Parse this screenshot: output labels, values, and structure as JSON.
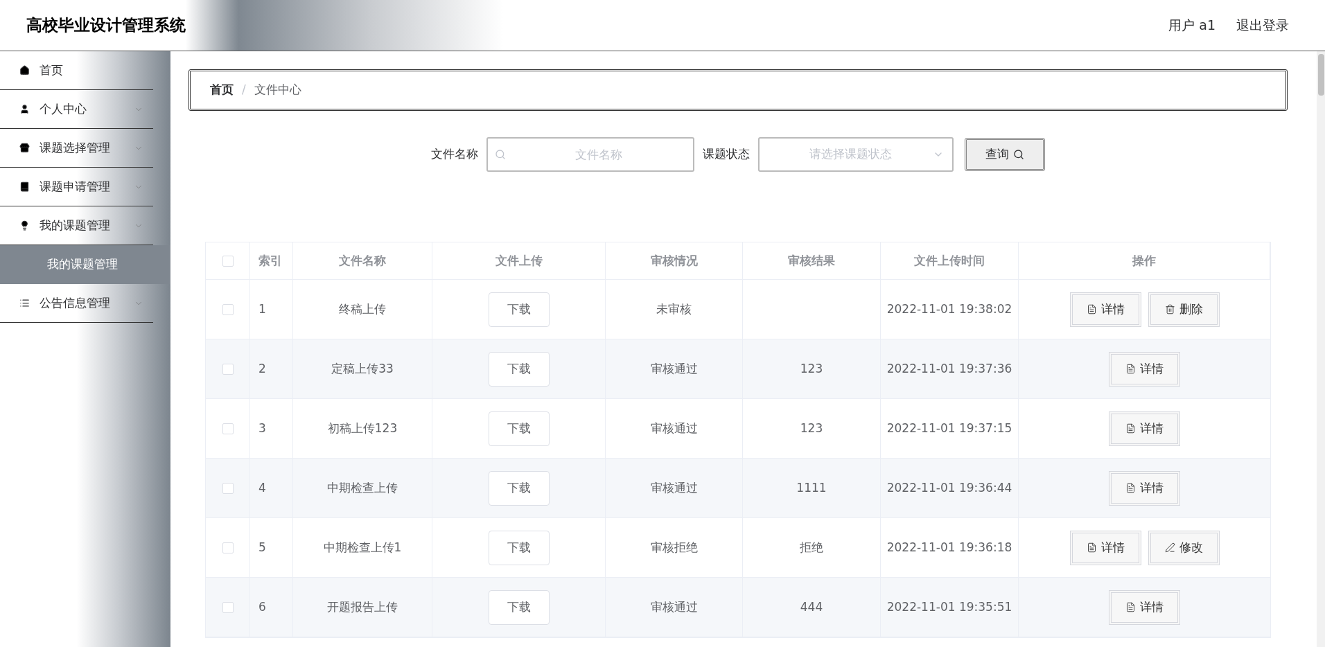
{
  "header": {
    "title": "高校毕业设计管理系统",
    "user": "用户 a1",
    "logout": "退出登录"
  },
  "sidebar": {
    "items": [
      {
        "label": "首页"
      },
      {
        "label": "个人中心"
      },
      {
        "label": "课题选择管理"
      },
      {
        "label": "课题申请管理"
      },
      {
        "label": "我的课题管理",
        "children": [
          {
            "label": "我的课题管理",
            "selected": true
          }
        ]
      },
      {
        "label": "公告信息管理"
      }
    ]
  },
  "breadcrumb": {
    "items": [
      "首页",
      "文件中心"
    ],
    "separator": "/"
  },
  "search": {
    "name_label": "文件名称",
    "name_placeholder": "文件名称",
    "status_label": "课题状态",
    "status_placeholder": "请选择课题状态",
    "query": "查询"
  },
  "table": {
    "select_all_checked": false,
    "columns": [
      "索引",
      "文件名称",
      "文件上传",
      "审核情况",
      "审核结果",
      "文件上传时间",
      "操作"
    ],
    "rows": [
      {
        "index": "1",
        "name": "终稿上传",
        "download": "下载",
        "audit": "未审核",
        "result": "",
        "time": "2022-11-01 19:38:02",
        "checked": false,
        "actions": [
          {
            "kind": "detail",
            "label": "详情"
          },
          {
            "kind": "delete",
            "label": "删除"
          }
        ]
      },
      {
        "index": "2",
        "name": "定稿上传33",
        "download": "下载",
        "audit": "审核通过",
        "result": "123",
        "time": "2022-11-01 19:37:36",
        "checked": false,
        "actions": [
          {
            "kind": "detail",
            "label": "详情"
          }
        ]
      },
      {
        "index": "3",
        "name": "初稿上传123",
        "download": "下载",
        "audit": "审核通过",
        "result": "123",
        "time": "2022-11-01 19:37:15",
        "checked": false,
        "actions": [
          {
            "kind": "detail",
            "label": "详情"
          }
        ]
      },
      {
        "index": "4",
        "name": "中期检查上传",
        "download": "下载",
        "audit": "审核通过",
        "result": "1111",
        "time": "2022-11-01 19:36:44",
        "checked": false,
        "actions": [
          {
            "kind": "detail",
            "label": "详情"
          }
        ]
      },
      {
        "index": "5",
        "name": "中期检查上传1",
        "download": "下载",
        "audit": "审核拒绝",
        "result": "拒绝",
        "time": "2022-11-01 19:36:18",
        "checked": false,
        "actions": [
          {
            "kind": "detail",
            "label": "详情"
          },
          {
            "kind": "edit",
            "label": "修改"
          }
        ]
      },
      {
        "index": "6",
        "name": "开题报告上传",
        "download": "下载",
        "audit": "审核通过",
        "result": "444",
        "time": "2022-11-01 19:35:51",
        "checked": false,
        "actions": [
          {
            "kind": "detail",
            "label": "详情"
          }
        ]
      }
    ]
  }
}
